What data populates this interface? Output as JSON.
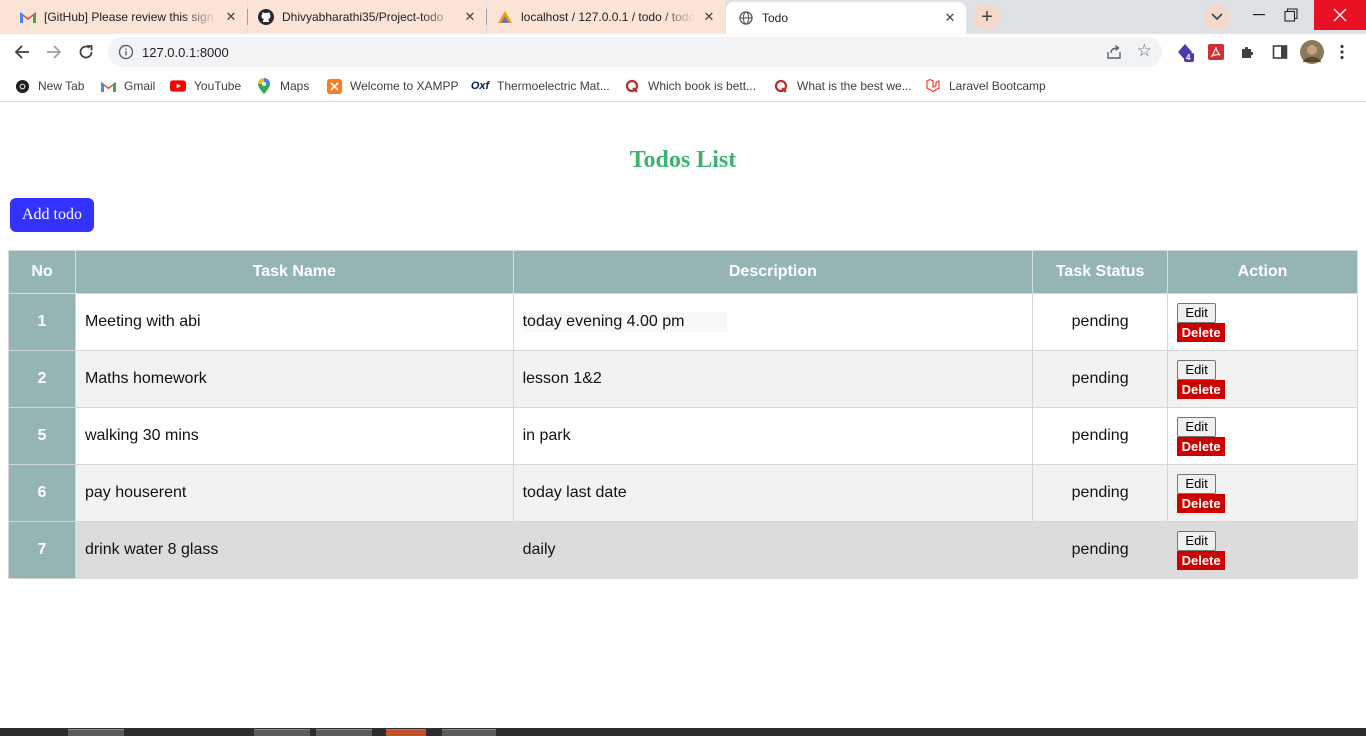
{
  "browser": {
    "tabs": [
      {
        "title": "[GitHub] Please review this sign in",
        "icon": "gmail-icon",
        "active": false
      },
      {
        "title": "Dhivyabharathi35/Project-todo",
        "icon": "github-icon",
        "active": false
      },
      {
        "title": "localhost / 127.0.0.1 / todo / todos",
        "icon": "phpmyadmin-icon",
        "active": false
      },
      {
        "title": "Todo",
        "icon": "globe-icon",
        "active": true
      }
    ],
    "url": "127.0.0.1:8000",
    "extension_badge": "4",
    "bookmarks": [
      {
        "label": "New Tab",
        "icon": "chrome-icon"
      },
      {
        "label": "Gmail",
        "icon": "gmail-icon"
      },
      {
        "label": "YouTube",
        "icon": "youtube-icon"
      },
      {
        "label": "Maps",
        "icon": "maps-icon"
      },
      {
        "label": "Welcome to XAMPP",
        "icon": "xampp-icon"
      },
      {
        "label": "Thermoelectric Mat...",
        "icon": "oxford-icon"
      },
      {
        "label": "Which book is bett...",
        "icon": "quora-icon"
      },
      {
        "label": "What is the best we...",
        "icon": "quora-icon"
      },
      {
        "label": "Laravel Bootcamp",
        "icon": "laravel-icon"
      }
    ]
  },
  "page": {
    "title": "Todos List",
    "add_button": "Add todo",
    "columns": [
      "No",
      "Task Name",
      "Description",
      "Task Status",
      "Action"
    ],
    "rows": [
      {
        "no": "1",
        "task": "Meeting with abi",
        "description": "today evening 4.00 pm",
        "status": "pending"
      },
      {
        "no": "2",
        "task": "Maths homework",
        "description": "lesson 1&2",
        "status": "pending"
      },
      {
        "no": "5",
        "task": "walking 30 mins",
        "description": "in park",
        "status": "pending"
      },
      {
        "no": "6",
        "task": "pay houserent",
        "description": "today last date",
        "status": "pending"
      },
      {
        "no": "7",
        "task": "drink water 8 glass",
        "description": "daily",
        "status": "pending"
      }
    ],
    "edit_label": "Edit",
    "delete_label": "Delete"
  },
  "colors": {
    "title_green": "#3cb371",
    "add_button_blue": "#3333ff",
    "header_teal": "#95b5b5",
    "delete_red": "#cc0000"
  }
}
